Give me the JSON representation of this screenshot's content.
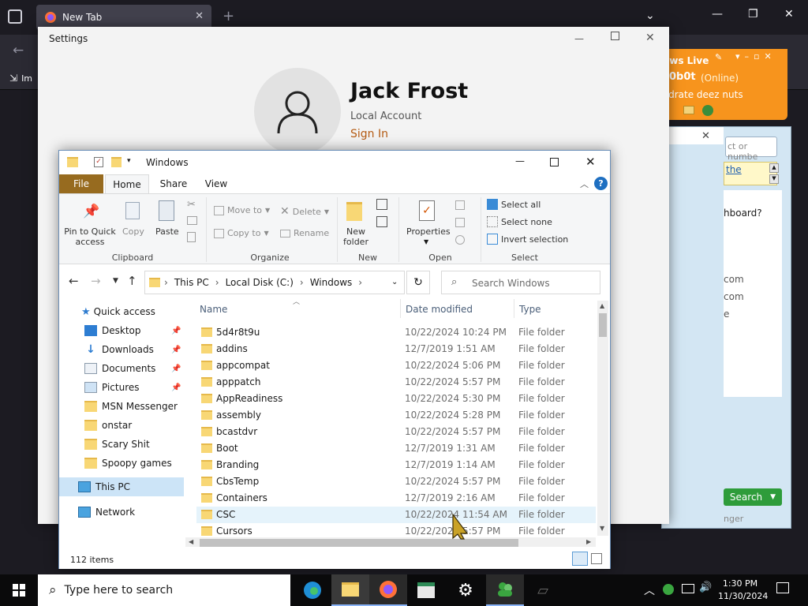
{
  "browser": {
    "tab_title": "New Tab",
    "bookmark_label": "Im"
  },
  "settings": {
    "title": "Settings",
    "user_name": "Jack Frost",
    "account_type": "Local Account",
    "sign_in": "Sign In"
  },
  "messenger": {
    "title": "ows Live",
    "user": "0b0t",
    "status": "(Online)",
    "message": "ydrate deez nuts",
    "search_placeholder": "ct or numbe",
    "link": "the",
    "question": "hboard?",
    "contacts": [
      "com",
      "com",
      "e"
    ],
    "search_button": "Search",
    "footer": "nger"
  },
  "explorer": {
    "title": "Windows",
    "tabs": {
      "file": "File",
      "home": "Home",
      "share": "Share",
      "view": "View"
    },
    "ribbon": {
      "pin": "Pin to Quick access",
      "copy": "Copy",
      "paste": "Paste",
      "move_to": "Move to",
      "copy_to": "Copy to",
      "delete": "Delete",
      "rename": "Rename",
      "new_folder": "New folder",
      "properties": "Properties",
      "select_all": "Select all",
      "select_none": "Select none",
      "invert_selection": "Invert selection",
      "groups": {
        "clipboard": "Clipboard",
        "organize": "Organize",
        "new": "New",
        "open": "Open",
        "select": "Select"
      }
    },
    "address": {
      "this_pc": "This PC",
      "disk": "Local Disk (C:)",
      "folder": "Windows"
    },
    "search_placeholder": "Search Windows",
    "nav": {
      "quick_access": "Quick access",
      "desktop": "Desktop",
      "downloads": "Downloads",
      "documents": "Documents",
      "pictures": "Pictures",
      "msn": "MSN Messenger",
      "onstar": "onstar",
      "scary": "Scary Shit",
      "spoopy": "Spoopy games",
      "this_pc": "This PC",
      "network": "Network"
    },
    "columns": {
      "name": "Name",
      "date": "Date modified",
      "type": "Type"
    },
    "rows": [
      {
        "name": "5d4r8t9u",
        "date": "10/22/2024 10:24 PM",
        "type": "File folder"
      },
      {
        "name": "addins",
        "date": "12/7/2019 1:51 AM",
        "type": "File folder"
      },
      {
        "name": "appcompat",
        "date": "10/22/2024 5:06 PM",
        "type": "File folder"
      },
      {
        "name": "apppatch",
        "date": "10/22/2024 5:57 PM",
        "type": "File folder"
      },
      {
        "name": "AppReadiness",
        "date": "10/22/2024 5:30 PM",
        "type": "File folder"
      },
      {
        "name": "assembly",
        "date": "10/22/2024 5:28 PM",
        "type": "File folder"
      },
      {
        "name": "bcastdvr",
        "date": "10/22/2024 5:57 PM",
        "type": "File folder"
      },
      {
        "name": "Boot",
        "date": "12/7/2019 1:31 AM",
        "type": "File folder"
      },
      {
        "name": "Branding",
        "date": "12/7/2019 1:14 AM",
        "type": "File folder"
      },
      {
        "name": "CbsTemp",
        "date": "10/22/2024 5:57 PM",
        "type": "File folder"
      },
      {
        "name": "Containers",
        "date": "12/7/2019 2:16 AM",
        "type": "File folder"
      },
      {
        "name": "CSC",
        "date": "10/22/2024 11:54 AM",
        "type": "File folder"
      },
      {
        "name": "Cursors",
        "date": "10/22/2024 5:57 PM",
        "type": "File folder"
      }
    ],
    "status": "112 items"
  },
  "taskbar": {
    "search_placeholder": "Type here to search",
    "time": "1:30 PM",
    "date": "11/30/2024"
  }
}
